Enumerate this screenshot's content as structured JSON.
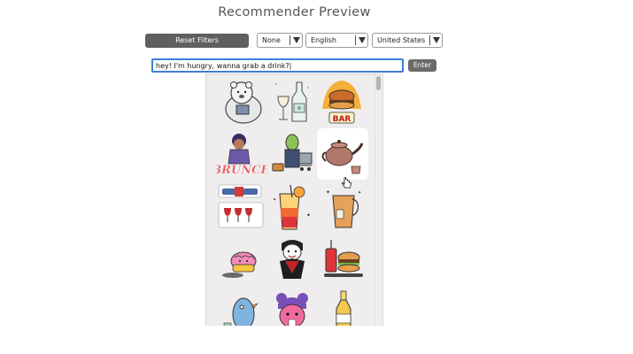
{
  "header": {
    "title": "Recommender Preview"
  },
  "filters": {
    "reset_label": "Reset Filters",
    "dropdowns": [
      {
        "value": "None"
      },
      {
        "value": "English"
      },
      {
        "value": "United States"
      }
    ]
  },
  "search": {
    "value": "hey! I'm hungry, wanna grab a drink?|",
    "enter_label": "Enter"
  },
  "stickers": [
    {
      "icon": "polar-bear-reading-sticker"
    },
    {
      "icon": "wine-bottle-glass-sticker"
    },
    {
      "icon": "burger-bar-sticker",
      "text": "BAR"
    },
    {
      "icon": "brunch-sticker",
      "text": "BRUNCH"
    },
    {
      "icon": "green-character-cart-sticker"
    },
    {
      "icon": "teapot-sticker"
    },
    {
      "icon": "wine-bottle-glasses-sticker"
    },
    {
      "icon": "orange-cocktail-sticker"
    },
    {
      "icon": "iced-coffee-sticker"
    },
    {
      "icon": "pink-brain-sticker"
    },
    {
      "icon": "vampire-sticker"
    },
    {
      "icon": "burger-fries-soda-sticker"
    },
    {
      "icon": "bird-soda-sticker"
    },
    {
      "icon": "pink-girl-sticker"
    },
    {
      "icon": "beer-bottle-sticker"
    }
  ],
  "colors": {
    "accent": "#3d7fd6",
    "button": "#5f5f5f",
    "panel": "#efeded"
  }
}
